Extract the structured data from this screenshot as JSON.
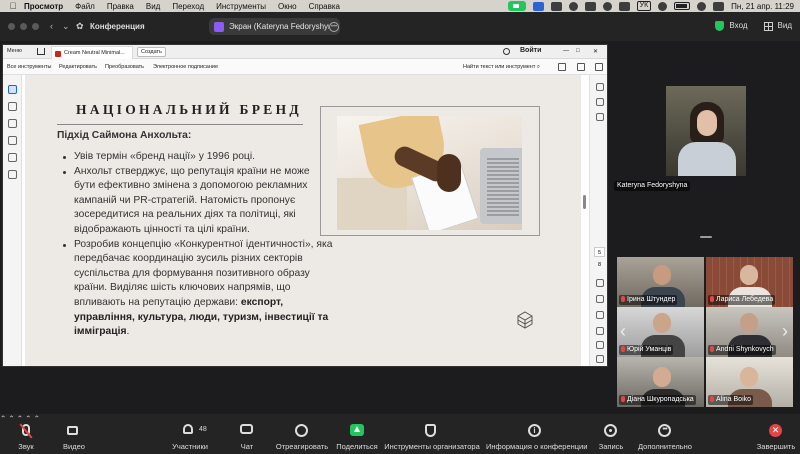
{
  "menubar": {
    "items": [
      "Просмотр",
      "Файл",
      "Правка",
      "Вид",
      "Переход",
      "Инструменты",
      "Окно",
      "Справка"
    ],
    "keyboard": "УК",
    "clock": "Пн, 21 апр.  11:29"
  },
  "zoom_bar": {
    "meeting_label": "Конференция",
    "share_title": "Экран (Kateryna Fedoryshyna)",
    "signin": "Вход",
    "view": "Вид"
  },
  "acrobat": {
    "tabs": {
      "menu": "Меню",
      "doc": "Cream Neutral Minimal...",
      "new": "Создать",
      "signin": "Войти"
    },
    "tools": {
      "items": [
        "Все инструменты",
        "Редактировать",
        "Преобразовать",
        "Электронное подписание"
      ],
      "find": "Найти текст или инструмент"
    },
    "page_current": "5",
    "page_total": "8"
  },
  "slide": {
    "title": "НАЦІОНАЛЬНИЙ БРЕНД",
    "subtitle": "Підхід Саймона Анхольта:",
    "bullets": [
      {
        "text": "Увів термін «бренд нації» у 1996 році.",
        "bold": ""
      },
      {
        "text": "Анхольт стверджує, що репутація країни не може бути ефективно змінена з допомогою рекламних кампаній чи PR-стратегій. Натомість пропонує зосередитися на реальних діях та політиці, які відображають цінності та цілі країни.",
        "bold": ""
      },
      {
        "text": "Розробив концепцію «Конкурентної ідентичності», яка передбачає координацію зусиль різних секторів суспільства для формування позитивного образу країни. Виділяє шість ключових напрямів, що впливають на репутацію держави: ",
        "bold": "експорт, управління, культура, люди, туризм, інвестиції та імміграція",
        "tail": "."
      }
    ]
  },
  "self_view": {
    "name": "Kateryna Fedoryshyna"
  },
  "participants": [
    {
      "name": "Ірина Штундер"
    },
    {
      "name": "Лариса Лебедева"
    },
    {
      "name": "Юрій Уманців"
    },
    {
      "name": "Andrii Shynkovych"
    },
    {
      "name": "Діана Шкуропадська"
    },
    {
      "name": "Alina Boiko"
    }
  ],
  "toolbar": {
    "mute": "Звук",
    "video": "Видео",
    "participants": "Участники",
    "participants_count": "48",
    "chat": "Чат",
    "react": "Отреагировать",
    "share": "Поделиться",
    "host_tools": "Инструменты организатора",
    "info": "Информация о конференции",
    "record": "Запись",
    "more": "Дополнительно",
    "end": "Завершить"
  }
}
